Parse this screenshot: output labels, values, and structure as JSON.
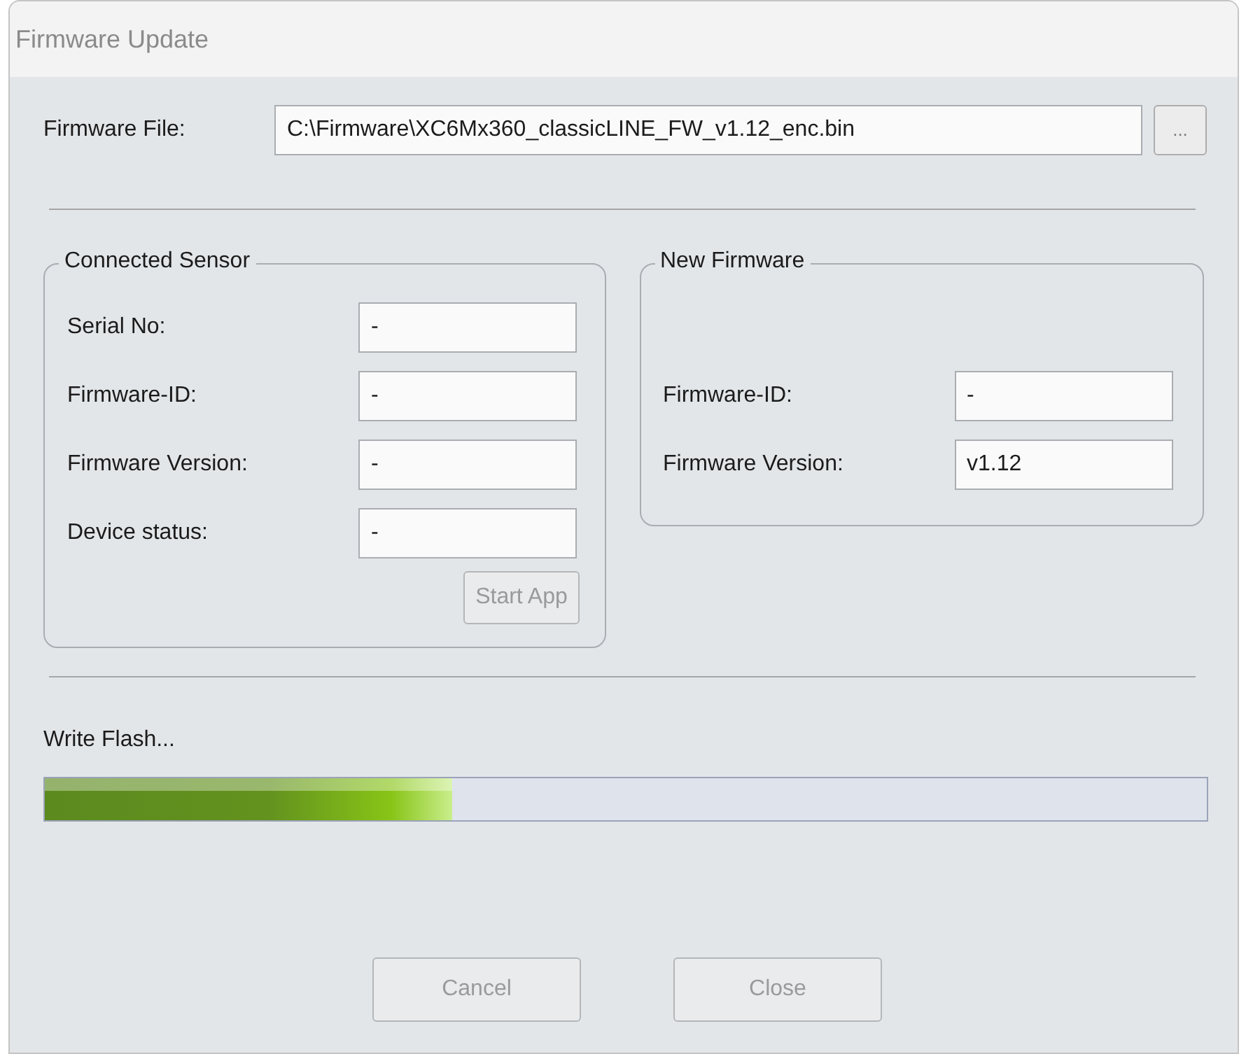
{
  "window": {
    "title": "Firmware Update"
  },
  "firmware_file": {
    "label": "Firmware File:",
    "value": "C:\\Firmware\\XC6Mx360_classicLINE_FW_v1.12_enc.bin",
    "browse_button": "..."
  },
  "connected_sensor": {
    "title": "Connected Sensor",
    "fields": [
      {
        "label": "Serial No:",
        "value": "-"
      },
      {
        "label": "Firmware-ID:",
        "value": "-"
      },
      {
        "label": "Firmware Version:",
        "value": "-"
      },
      {
        "label": "Device status:",
        "value": "-"
      }
    ],
    "start_app": {
      "label": "Start App",
      "disabled": true
    }
  },
  "new_firmware": {
    "title": "New Firmware",
    "fields": [
      {
        "label": "Firmware-ID:",
        "value": "-"
      },
      {
        "label": "Firmware Version:",
        "value": "v1.12"
      }
    ]
  },
  "progress": {
    "label": "Write Flash...",
    "level": 0.35
  },
  "buttons": [
    {
      "label": "Cancel",
      "disabled": true
    },
    {
      "label": "Close",
      "disabled": true
    }
  ]
}
